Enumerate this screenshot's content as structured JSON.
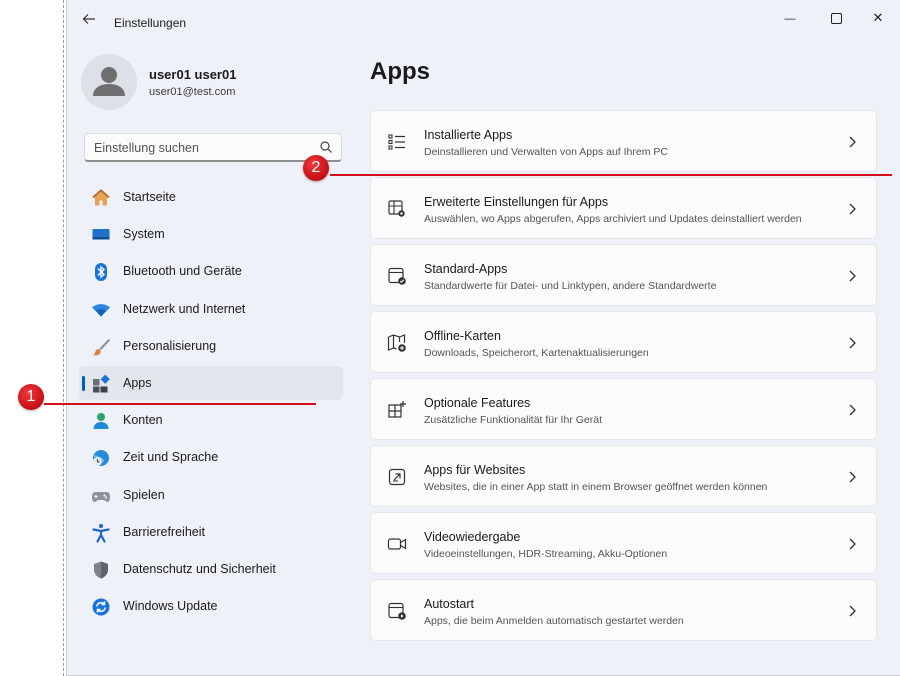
{
  "window": {
    "title": "Einstellungen",
    "minimize_glyph": "—",
    "close_glyph": "✕"
  },
  "profile": {
    "name": "user01 user01",
    "email": "user01@test.com"
  },
  "search": {
    "placeholder": "Einstellung suchen"
  },
  "sidebar": {
    "active_index": 6,
    "items": [
      {
        "label": "Startseite",
        "icon": "home-icon"
      },
      {
        "label": "System",
        "icon": "monitor-icon"
      },
      {
        "label": "Bluetooth und Geräte",
        "icon": "bluetooth-icon"
      },
      {
        "label": "Netzwerk und Internet",
        "icon": "wifi-icon"
      },
      {
        "label": "Personalisierung",
        "icon": "brush-icon"
      },
      {
        "label": "Apps",
        "icon": "apps-icon"
      },
      {
        "label": "Konten",
        "icon": "person-icon"
      },
      {
        "label": "Zeit und Sprache",
        "icon": "globe-clock-icon"
      },
      {
        "label": "Spielen",
        "icon": "gamepad-icon"
      },
      {
        "label": "Barrierefreiheit",
        "icon": "accessibility-icon"
      },
      {
        "label": "Datenschutz und Sicherheit",
        "icon": "shield-icon"
      },
      {
        "label": "Windows Update",
        "icon": "update-icon"
      }
    ]
  },
  "main": {
    "title": "Apps",
    "cards": [
      {
        "title": "Installierte Apps",
        "subtitle": "Deinstallieren und Verwalten von Apps auf Ihrem PC",
        "icon": "app-list-icon"
      },
      {
        "title": "Erweiterte Einstellungen für Apps",
        "subtitle": "Auswählen, wo Apps abgerufen, Apps archiviert und Updates deinstalliert werden",
        "icon": "app-settings-icon"
      },
      {
        "title": "Standard-Apps",
        "subtitle": "Standardwerte für Datei- und Linktypen, andere Standardwerte",
        "icon": "default-apps-icon"
      },
      {
        "title": "Offline-Karten",
        "subtitle": "Downloads, Speicherort, Kartenaktualisierungen",
        "icon": "offline-map-icon"
      },
      {
        "title": "Optionale Features",
        "subtitle": "Zusätzliche Funktionalität für Ihr Gerät",
        "icon": "optional-features-icon"
      },
      {
        "title": "Apps für Websites",
        "subtitle": "Websites, die in einer App statt in einem Browser geöffnet werden können",
        "icon": "website-app-icon"
      },
      {
        "title": "Videowiedergabe",
        "subtitle": "Videoeinstellungen, HDR-Streaming, Akku-Optionen",
        "icon": "video-icon"
      },
      {
        "title": "Autostart",
        "subtitle": "Apps, die beim Anmelden automatisch gestartet werden",
        "icon": "startup-icon"
      }
    ]
  },
  "annotations": [
    {
      "number": "1"
    },
    {
      "number": "2"
    }
  ],
  "colors": {
    "accent": "#005fb8",
    "annotation": "#d40f1c"
  }
}
